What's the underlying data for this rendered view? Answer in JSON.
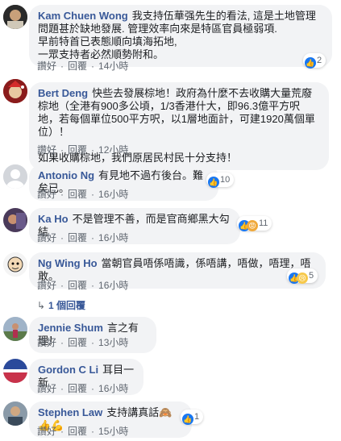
{
  "labels": {
    "like": "讚好",
    "reply": "回覆",
    "dot": "·"
  },
  "comments": [
    {
      "name": "Kam Chuen Wong",
      "text": "我支持伍華强先生的看法, 這是土地管理問題甚於缺地發展. 管理效率向來是特區官員極弱項.\n早前特首已表態順向填海拓地,\n一眾支持者必然順勢附和。",
      "time": "14小時",
      "reactions": "2"
    },
    {
      "name": "Bert Deng",
      "text": "快些去發展棕地！政府為什麼不去收購大量荒廢棕地（全港有900多公頃，1/3香港什大，即96.3億平方呎地，若每個單位500平方呎，以1層地面計，可建1920萬個單位）！\n\n如果收購棕地，我們原居民村民十分支持！",
      "time": "12小時",
      "reactions": ""
    },
    {
      "name": "Antonio Ng",
      "text": "有見地不過冇後台。難矣已。",
      "time": "16小時",
      "reactions": "10"
    },
    {
      "name": "Ka Ho",
      "text": "不是管理不善，而是官商鄉黑大勾結",
      "time": "16小時",
      "reactions": "11"
    },
    {
      "name": "Ng Wing Ho",
      "text": "當朝官員唔係唔識，係唔講，唔做，唔理，唔敢。",
      "time": "16小時",
      "reactions": "5"
    },
    {
      "name": "Jennie Shum",
      "text": "言之有理！",
      "time": "13小時",
      "reactions": ""
    },
    {
      "name": "Gordon C Li",
      "text": "耳目一新",
      "time": "16小時",
      "reactions": ""
    },
    {
      "name": "Stephen Law",
      "text": "支持講真話🙈👍💪",
      "time": "15小時",
      "reactions": "1"
    }
  ],
  "replies": {
    "label": "1 個回覆"
  }
}
